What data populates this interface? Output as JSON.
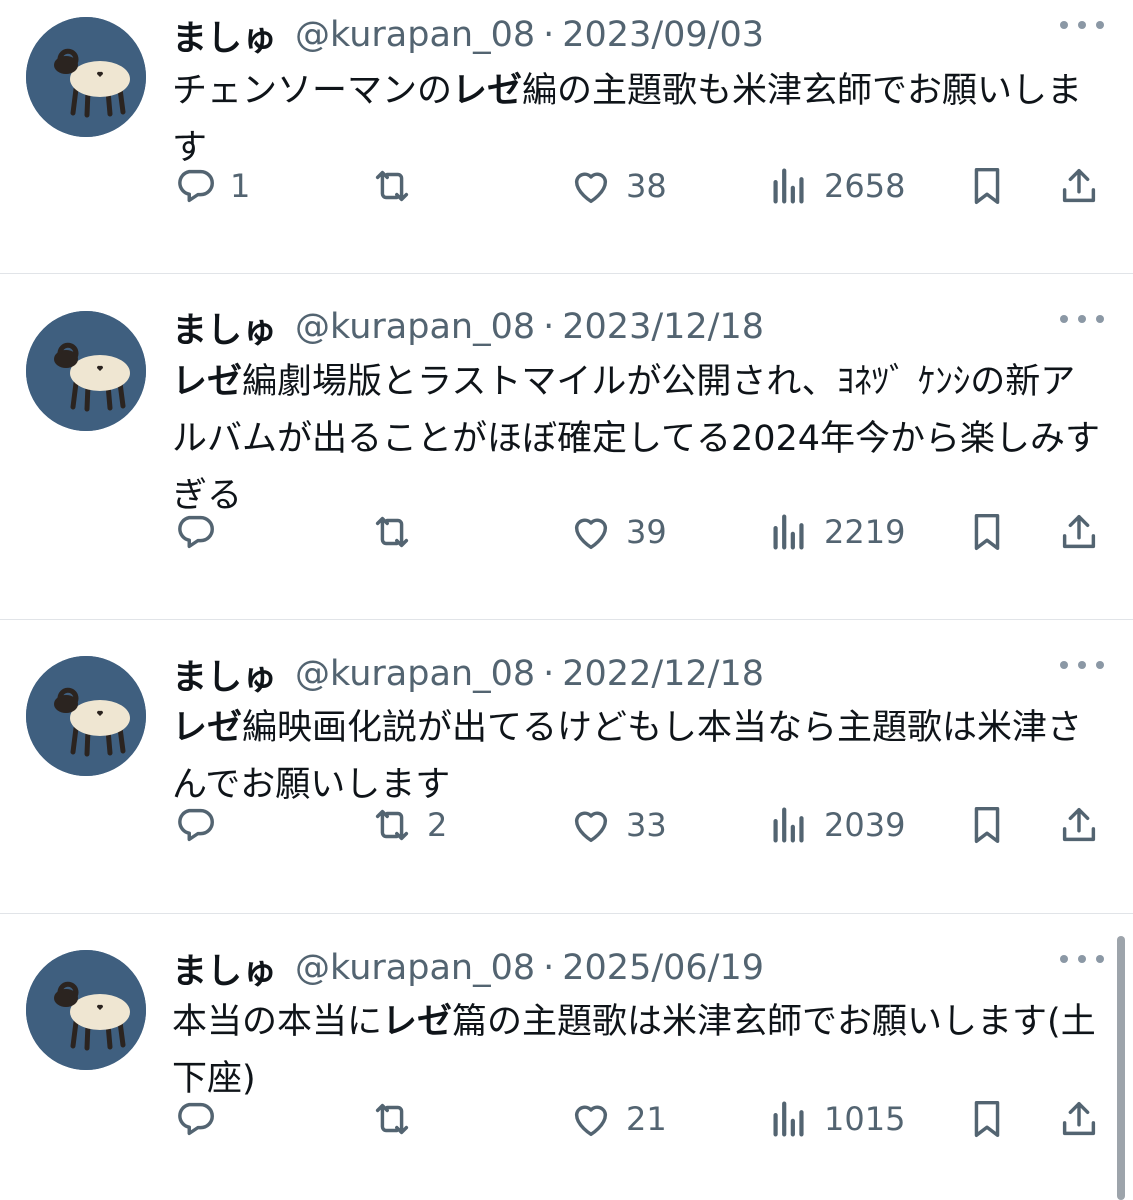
{
  "tweets": [
    {
      "name": "ましゅ",
      "handle": "@kurapan_08",
      "separator": "·",
      "date": "2023/09/03",
      "text_parts": [
        {
          "text": "チェンソーマンの",
          "bold": false
        },
        {
          "text": "レゼ",
          "bold": true
        },
        {
          "text": "編の主題歌も米津玄師でお願いします",
          "bold": false
        }
      ],
      "replies": "1",
      "retweets": "",
      "likes": "38",
      "views": "2658"
    },
    {
      "name": "ましゅ",
      "handle": "@kurapan_08",
      "separator": "·",
      "date": "2023/12/18",
      "text_parts": [
        {
          "text": "レゼ",
          "bold": true
        },
        {
          "text": "編劇場版とラストマイルが公開され、ﾖﾈﾂﾞ ｹﾝｼの新アルバムが出ることがほぼ確定してる2024年今から楽しみすぎる",
          "bold": false
        }
      ],
      "replies": "",
      "retweets": "",
      "likes": "39",
      "views": "2219"
    },
    {
      "name": "ましゅ",
      "handle": "@kurapan_08",
      "separator": "·",
      "date": "2022/12/18",
      "text_parts": [
        {
          "text": "レゼ",
          "bold": true
        },
        {
          "text": "編映画化説が出てるけどもし本当なら主題歌は米津さんでお願いします",
          "bold": false
        }
      ],
      "replies": "",
      "retweets": "2",
      "likes": "33",
      "views": "2039"
    },
    {
      "name": "ましゅ",
      "handle": "@kurapan_08",
      "separator": "·",
      "date": "2025/06/19",
      "text_parts": [
        {
          "text": "本当の本当に",
          "bold": false
        },
        {
          "text": "レゼ",
          "bold": true
        },
        {
          "text": "篇の主題歌は米津玄師でお願いします(土下座)",
          "bold": false
        }
      ],
      "replies": "",
      "retweets": "",
      "likes": "21",
      "views": "1015"
    }
  ],
  "icons": [
    "reply-icon",
    "retweet-icon",
    "like-icon",
    "views-icon",
    "bookmark-icon",
    "share-icon",
    "more-icon"
  ],
  "colors": {
    "text": "#0f1419",
    "muted": "#536471",
    "avatar_bg": "#3f5f7f",
    "divider": "#e1e4e8"
  }
}
